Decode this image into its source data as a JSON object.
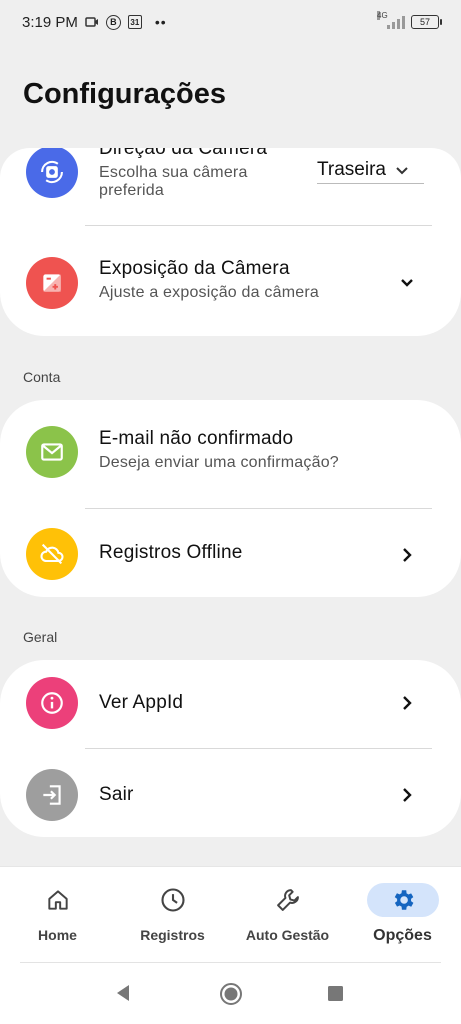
{
  "status_bar": {
    "time": "3:19 PM",
    "notif_b": "B",
    "notif_cal": "31",
    "dots": "••",
    "network": "4G",
    "battery": "57"
  },
  "page": {
    "title": "Configurações"
  },
  "camera": {
    "direction": {
      "title": "Direção da Câmera",
      "subtitle_line1": "Escolha sua câmera",
      "subtitle_line2": "preferida",
      "selected_option": "Traseira",
      "icon": "switch-camera-icon",
      "icon_color": "#4a6ae8"
    },
    "exposure": {
      "title": "Exposição da Câmera",
      "subtitle": "Ajuste a exposição da câmera",
      "icon": "exposure-icon",
      "icon_color": "#ef5350"
    }
  },
  "account": {
    "section_label": "Conta",
    "email": {
      "title": "E-mail não confirmado",
      "subtitle": "Deseja enviar uma confirmação?",
      "icon": "mail-icon",
      "icon_color": "#8bc34a"
    },
    "offline": {
      "title": "Registros Offline",
      "icon": "cloud-off-icon",
      "icon_color": "#ffc107"
    }
  },
  "general": {
    "section_label": "Geral",
    "appid": {
      "title": "Ver AppId",
      "icon": "info-icon",
      "icon_color": "#ec407a"
    },
    "logout": {
      "title": "Sair",
      "icon": "exit-icon",
      "icon_color": "#9e9e9e"
    }
  },
  "bottom_nav": {
    "items": [
      {
        "label": "Home",
        "icon": "home-icon"
      },
      {
        "label": "Registros",
        "icon": "clock-icon"
      },
      {
        "label": "Auto Gestão",
        "icon": "wrench-icon"
      },
      {
        "label": "Opções",
        "icon": "gear-icon",
        "active": true
      }
    ],
    "active_color": "#1565c0",
    "active_bg": "#d4e4fb"
  },
  "system_nav": {
    "icons": [
      "back-icon",
      "home-circle-icon",
      "recents-icon"
    ]
  }
}
